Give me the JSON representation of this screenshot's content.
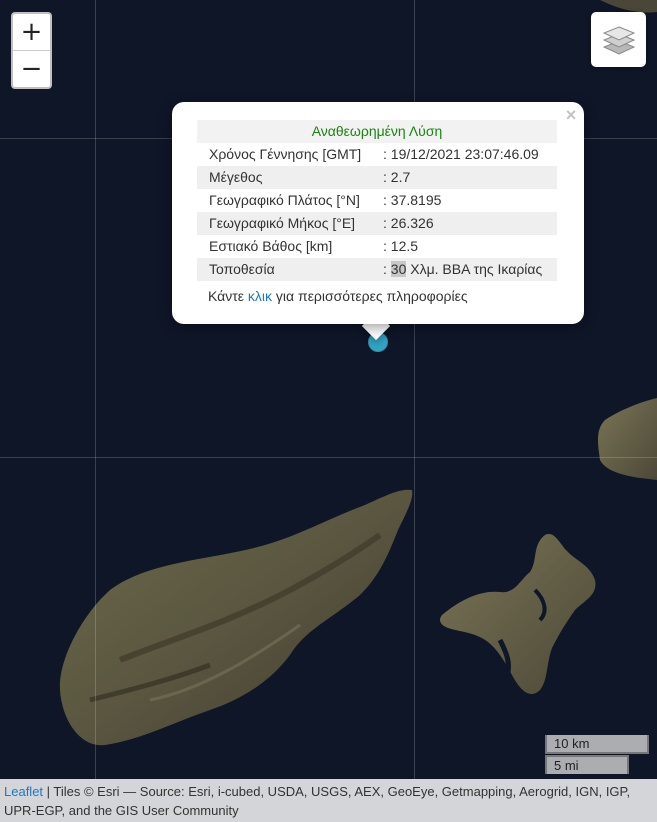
{
  "map": {
    "controls": {
      "zoom_in": "+",
      "zoom_out": "−",
      "layers_icon": "layers-icon"
    },
    "marker": {
      "color": "#32a6c6"
    }
  },
  "popup": {
    "close": "×",
    "header": "Αναθεωρημένη Λύση",
    "rows": [
      {
        "key": "Χρόνος Γέννησης [GMT]",
        "value": ": 19/12/2021 23:07:46.09"
      },
      {
        "key": "Μέγεθος",
        "value": ": 2.7"
      },
      {
        "key": "Γεωγραφικό Πλάτος [°N]",
        "value": ": 37.8195"
      },
      {
        "key": "Γεωγραφικό Μήκος [°E]",
        "value": ": 26.326"
      },
      {
        "key": "Εστιακό Βάθος [km]",
        "value": ": 12.5"
      },
      {
        "key": "Τοποθεσία",
        "value_prefix": ": ",
        "value_highlight": "30",
        "value_rest": " Χλμ. ΒΒΑ της Ικαρίας"
      }
    ],
    "more": {
      "before": "Κάντε ",
      "link": "κλικ",
      "after": " για περισσότερες πληροφορίες"
    }
  },
  "scale": {
    "metric": "10 km",
    "imperial": "5 mi"
  },
  "attribution": {
    "leaflet": "Leaflet",
    "text": " | Tiles © Esri — Source: Esri, i-cubed, USDA, USGS, AEX, GeoEye, Getmapping, Aerogrid, IGN, IGP, UPR-EGP, and the GIS User Community"
  }
}
